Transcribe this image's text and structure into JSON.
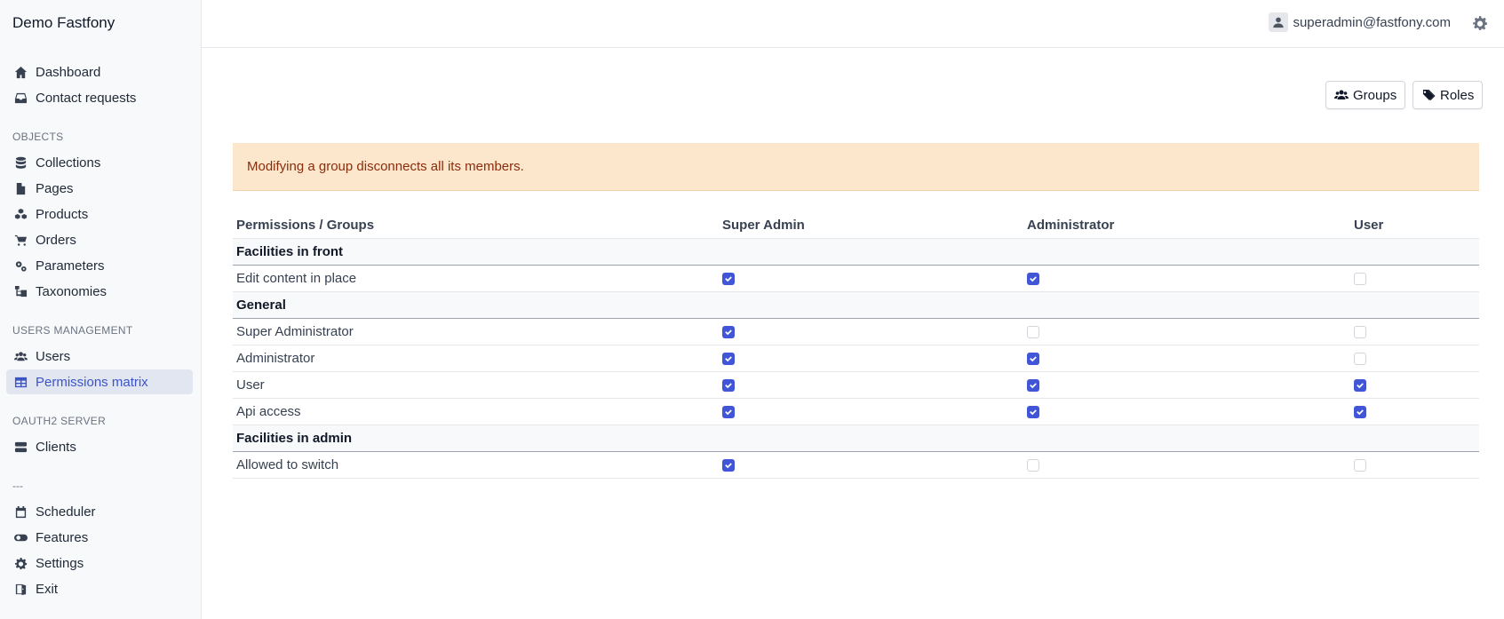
{
  "brand": "Demo Fastfony",
  "sidebar": {
    "top_items": [
      {
        "label": "Dashboard",
        "icon": "home-icon"
      },
      {
        "label": "Contact requests",
        "icon": "inbox-icon"
      }
    ],
    "sections": [
      {
        "title": "OBJECTS",
        "items": [
          {
            "label": "Collections",
            "icon": "database-icon"
          },
          {
            "label": "Pages",
            "icon": "file-icon"
          },
          {
            "label": "Products",
            "icon": "cubes-icon"
          },
          {
            "label": "Orders",
            "icon": "cart-icon"
          },
          {
            "label": "Parameters",
            "icon": "cogs-icon"
          },
          {
            "label": "Taxonomies",
            "icon": "sitemap-icon"
          }
        ]
      },
      {
        "title": "USERS MANAGEMENT",
        "items": [
          {
            "label": "Users",
            "icon": "users-icon"
          },
          {
            "label": "Permissions matrix",
            "icon": "table-icon",
            "active": true
          }
        ]
      },
      {
        "title": "OAUTH2 SERVER",
        "items": [
          {
            "label": "Clients",
            "icon": "server-icon"
          }
        ]
      }
    ],
    "divider": "---",
    "bottom_items": [
      {
        "label": "Scheduler",
        "icon": "calendar-icon"
      },
      {
        "label": "Features",
        "icon": "toggle-icon"
      },
      {
        "label": "Settings",
        "icon": "gear-icon"
      },
      {
        "label": "Exit",
        "icon": "door-icon"
      }
    ]
  },
  "header": {
    "user_email": "superadmin@fastfony.com"
  },
  "toolbar": {
    "groups_label": "Groups",
    "roles_label": "Roles"
  },
  "alert": "Modifying a group disconnects all its members.",
  "matrix": {
    "columns": [
      "Permissions / Groups",
      "Super Admin",
      "Administrator",
      "User"
    ],
    "groups": [
      {
        "name": "Facilities in front",
        "rows": [
          {
            "label": "Edit content in place",
            "values": [
              true,
              true,
              false
            ]
          }
        ]
      },
      {
        "name": "General",
        "rows": [
          {
            "label": "Super Administrator",
            "values": [
              true,
              false,
              false
            ]
          },
          {
            "label": "Administrator",
            "values": [
              true,
              true,
              false
            ]
          },
          {
            "label": "User",
            "values": [
              true,
              true,
              true
            ]
          },
          {
            "label": "Api access",
            "values": [
              true,
              true,
              true
            ]
          }
        ]
      },
      {
        "name": "Facilities in admin",
        "rows": [
          {
            "label": "Allowed to switch",
            "values": [
              true,
              false,
              false
            ]
          }
        ]
      }
    ]
  },
  "colors": {
    "accent": "#4056d6",
    "active_nav_text": "#3b55c9",
    "alert_bg": "#fde7cc",
    "alert_text": "#8a2c0d"
  }
}
